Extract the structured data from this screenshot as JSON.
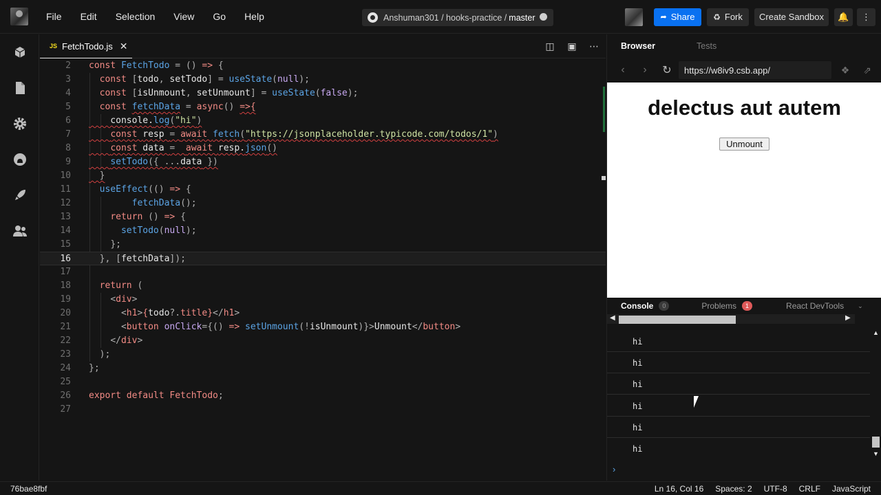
{
  "menu": [
    "File",
    "Edit",
    "Selection",
    "View",
    "Go",
    "Help"
  ],
  "repo": {
    "path": "Anshuman301 / hooks-practice /",
    "branch": "master"
  },
  "actions": {
    "share": "Share",
    "fork": "Fork",
    "create": "Create Sandbox"
  },
  "editor": {
    "tab_name": "FetchTodo.js",
    "tab_badge": "JS",
    "lines": [
      {
        "n": "2"
      },
      {
        "n": "3"
      },
      {
        "n": "4"
      },
      {
        "n": "5"
      },
      {
        "n": "6"
      },
      {
        "n": "7"
      },
      {
        "n": "8"
      },
      {
        "n": "9"
      },
      {
        "n": "10"
      },
      {
        "n": "11"
      },
      {
        "n": "12"
      },
      {
        "n": "13"
      },
      {
        "n": "14"
      },
      {
        "n": "15"
      },
      {
        "n": "16"
      },
      {
        "n": "17"
      },
      {
        "n": "18"
      },
      {
        "n": "19"
      },
      {
        "n": "20"
      },
      {
        "n": "21"
      },
      {
        "n": "22"
      },
      {
        "n": "23"
      },
      {
        "n": "24"
      },
      {
        "n": "25"
      },
      {
        "n": "26"
      },
      {
        "n": "27"
      }
    ],
    "code": {
      "l2": "const FetchTodo = () => {",
      "l3": "  const [todo, setTodo] = useState(null);",
      "l4": "  const [isUnmount, setUnmount] = useState(false);",
      "l5": "  const fetchData = async() =>{",
      "l6": "    console.log(\"hi\")",
      "l7": "    const resp = await fetch(\"https://jsonplaceholder.typicode.com/todos/1\")",
      "l8": "    const data =  await resp.json()",
      "l9": "    setTodo({ ...data })",
      "l10": "  }",
      "l11": "  useEffect(() => {",
      "l12": "        fetchData();",
      "l13": "    return () => {",
      "l14": "      setTodo(null);",
      "l15": "    };",
      "l16": "  }, [fetchData]);",
      "l17": "",
      "l18": "  return (",
      "l19": "    <div>",
      "l20": "      <h1>{todo?.title}</h1>",
      "l21": "      <button onClick={() => setUnmount(!isUnmount)}>Unmount</button>",
      "l22": "    </div>",
      "l23": "  );",
      "l24": "};",
      "l25": "",
      "l26": "export default FetchTodo;",
      "l27": ""
    }
  },
  "browser": {
    "tabs": [
      "Browser",
      "Tests"
    ],
    "url": "https://w8iv9.csb.app/",
    "heading": "delectus aut autem",
    "button": "Unmount"
  },
  "devtools": {
    "console_label": "Console",
    "console_count": "0",
    "problems_label": "Problems",
    "problems_count": "1",
    "react_label": "React DevTools",
    "logs": [
      "hi",
      "hi",
      "hi",
      "hi",
      "hi",
      "hi"
    ]
  },
  "status": {
    "hash": "76bae8fbf",
    "position": "Ln 16, Col 16",
    "spaces": "Spaces: 2",
    "encoding": "UTF-8",
    "eol": "CRLF",
    "language": "JavaScript"
  },
  "colors": {
    "accent": "#0971f1",
    "error_badge": "#e05a5a",
    "keyword": "#f28b85",
    "function": "#5ba4e5",
    "string": "#cfe3a4"
  },
  "icons": [
    "sandbox-icon",
    "files-icon",
    "settings-icon",
    "github-icon",
    "deploy-icon",
    "live-icon"
  ]
}
